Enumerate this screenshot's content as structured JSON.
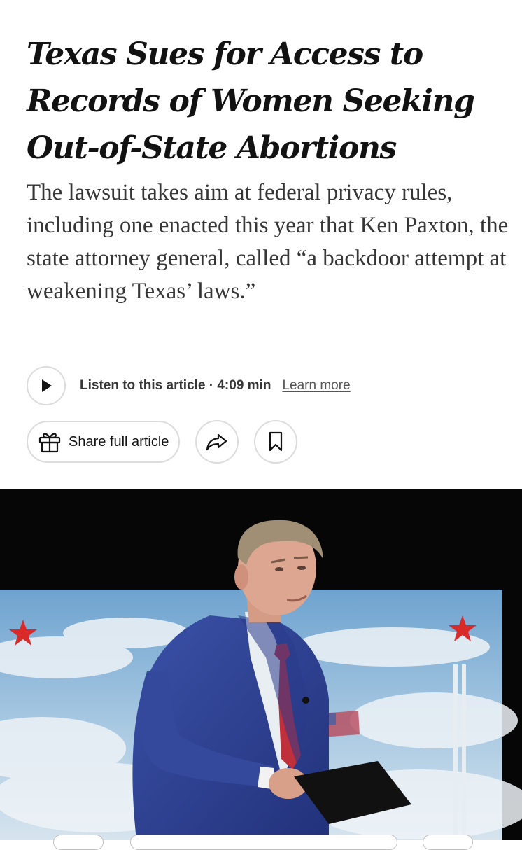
{
  "article": {
    "headline": "Texas Sues for Access to Records of Women Seeking Out-of-State Abortions",
    "summary": "The lawsuit takes aim at federal privacy rules, including one enacted this year that Ken Paxton, the state attorney general, called “a backdoor attempt at weakening Texas’ laws.”"
  },
  "audio": {
    "listen_label": "Listen to this article · 4:09 min",
    "learn_more_label": "Learn more"
  },
  "share": {
    "share_label": "Share full article"
  },
  "icons": {
    "play": "play-icon",
    "gift": "gift-icon",
    "share": "share-arrow-icon",
    "bookmark": "bookmark-icon"
  },
  "colors": {
    "text": "#121212",
    "summary_text": "#363636",
    "button_border": "#dcdcdc",
    "suit_blue": "#2d3f8c",
    "tie_red": "#c0303a",
    "star_red": "#d92a2a"
  }
}
